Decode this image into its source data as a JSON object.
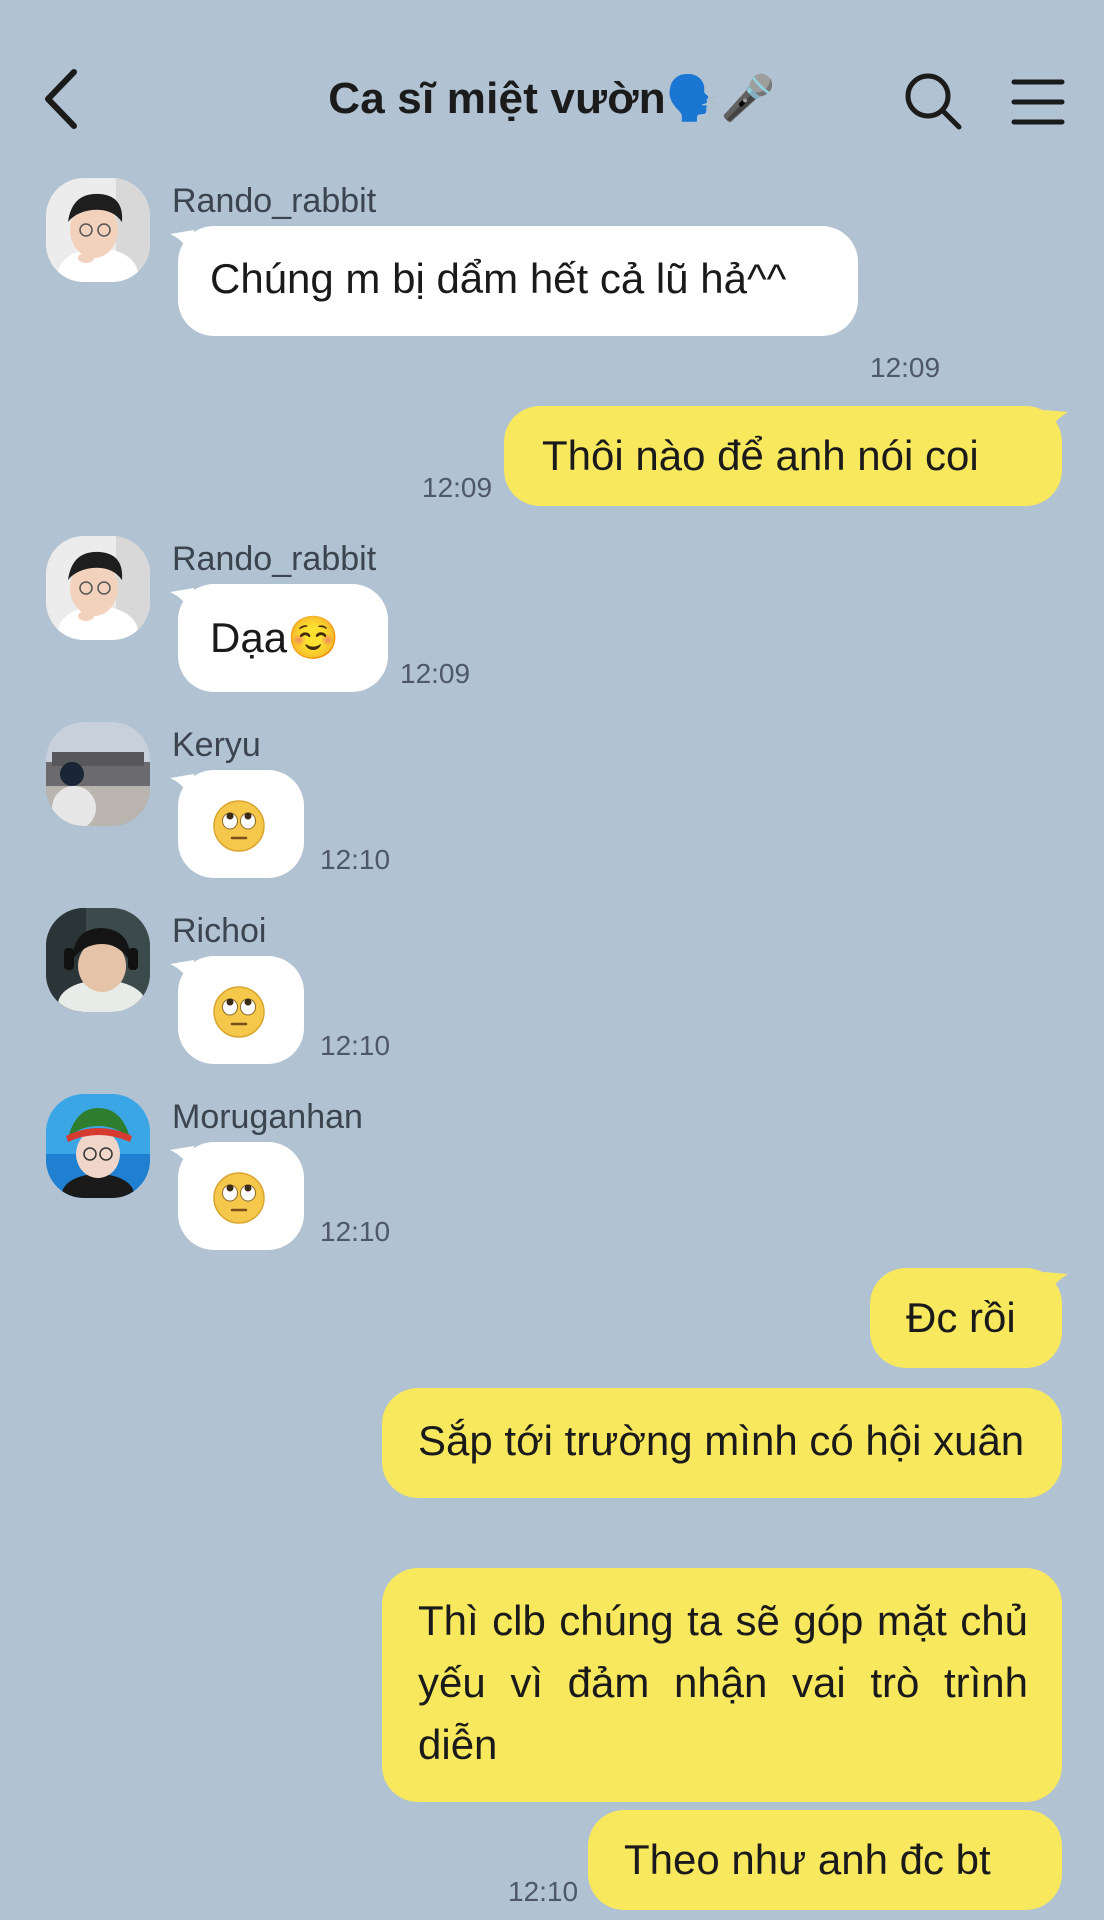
{
  "header": {
    "title": "Ca sĩ miệt vườn🗣️🎤"
  },
  "messages": [
    {
      "sender": "Rando_rabbit",
      "text": "Chúng m bị dẩm hết cả lũ hả^^",
      "time": "12:09"
    },
    {
      "text": "Thôi nào để anh nói coi",
      "time": "12:09"
    },
    {
      "sender": "Rando_rabbit",
      "text": "Dạa☺️",
      "time": "12:09"
    },
    {
      "sender": "Keryu",
      "emoji": "rolling-eyes-face",
      "time": "12:10"
    },
    {
      "sender": "Richoi",
      "emoji": "rolling-eyes-face",
      "time": "12:10"
    },
    {
      "sender": "Moruganhan",
      "emoji": "rolling-eyes-face",
      "time": "12:10"
    },
    {
      "text": "Đc rồi"
    },
    {
      "text": "Sắp tới trường mình có hội xuân"
    },
    {
      "text": "Thì clb chúng ta sẽ góp mặt chủ yếu vì đảm nhận vai trò trình diễn"
    },
    {
      "text": "Theo như anh đc bt",
      "time": "12:10"
    }
  ],
  "colors": {
    "background": "#b1c2d3",
    "incoming_bubble": "#ffffff",
    "outgoing_bubble": "#f8e85e"
  }
}
